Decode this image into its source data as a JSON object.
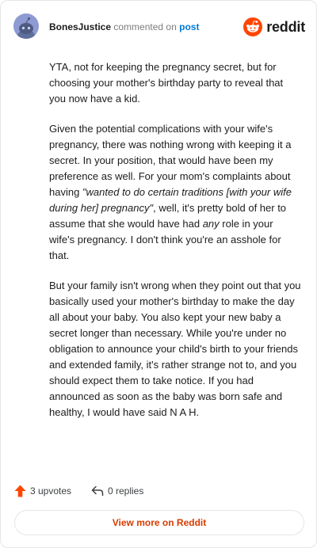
{
  "header": {
    "author": "BonesJustice",
    "action": "commented on",
    "post_link": "post",
    "brand": "reddit"
  },
  "comment": {
    "paragraphs": [
      [
        {
          "text": "YTA, not for keeping the pregnancy secret, but for choosing your mother's birthday party to reveal that you now have a kid.",
          "style": "normal"
        }
      ],
      [
        {
          "text": "Given the potential complications with your wife's pregnancy, there was nothing wrong with keeping it a secret. In your position, that would have been my preference as well. For your mom's complaints about having ",
          "style": "normal"
        },
        {
          "text": "\"wanted to do certain traditions [with your wife during her] pregnancy\"",
          "style": "italic"
        },
        {
          "text": ", well, it's pretty bold of her to assume that she would have had ",
          "style": "normal"
        },
        {
          "text": "any",
          "style": "italic"
        },
        {
          "text": " role in your wife's pregnancy. I don't think you're an asshole for that.",
          "style": "normal"
        }
      ],
      [
        {
          "text": "But your family isn't wrong when they point out that you basically used your mother's birthday to make the day all about your baby. You also kept your new baby a secret longer than necessary. While you're under no obligation to announce your child's birth to your friends and extended family, it's rather strange not to, and you should expect them to take notice. If you had announced as soon as the baby was born safe and healthy, I would have said N A H.",
          "style": "normal"
        }
      ]
    ]
  },
  "footer": {
    "upvotes": "3 upvotes",
    "replies": "0 replies",
    "view_more": "View more on Reddit"
  },
  "colors": {
    "upvote_accent": "#ff4500",
    "link_blue": "#0079d3",
    "view_more_text": "#d93a00",
    "brand_orange": "#ff4500",
    "avatar_bg": "#9aa7d9"
  },
  "icons": {
    "avatar": "snoo-avatar-icon",
    "brand": "reddit-logo-icon",
    "upvote": "upvote-arrow-icon",
    "reply": "reply-arrow-icon"
  }
}
